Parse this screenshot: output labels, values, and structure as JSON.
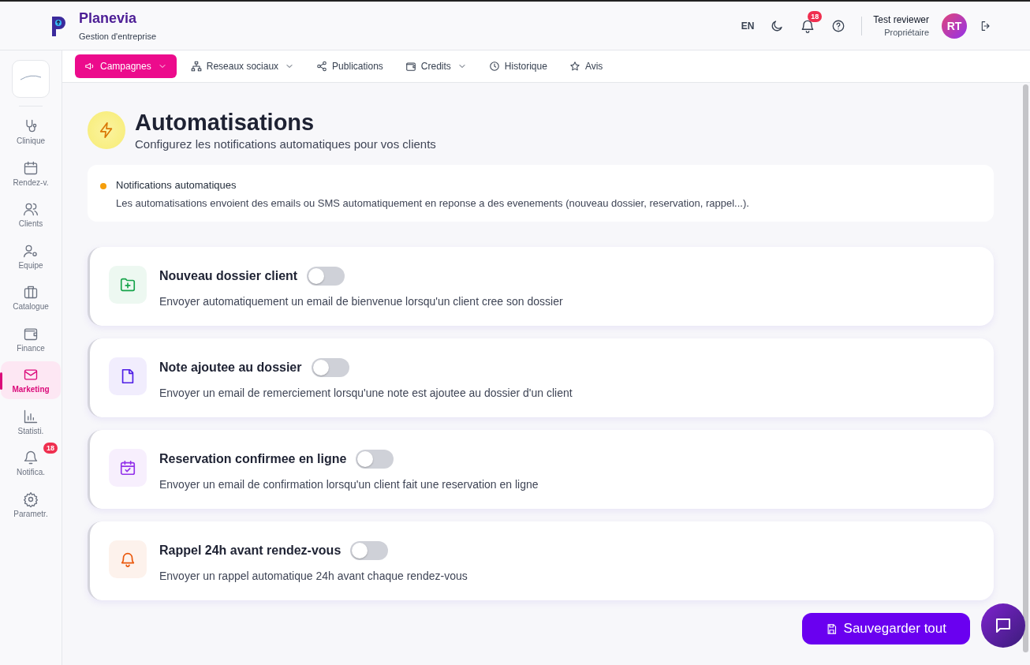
{
  "header": {
    "brand": "Planevia",
    "subtitle": "Gestion d'entreprise",
    "language": "EN",
    "notification_count": "18",
    "user_name": "Test reviewer",
    "user_role": "Propriétaire",
    "avatar_initials": "RT"
  },
  "sidebar": {
    "items": [
      {
        "label": "Clinique",
        "selected": false
      },
      {
        "label": "Rendez-v.",
        "selected": false
      },
      {
        "label": "Clients",
        "selected": false
      },
      {
        "label": "Equipe",
        "selected": false
      },
      {
        "label": "Catalogue",
        "selected": false
      },
      {
        "label": "Finance",
        "selected": false
      },
      {
        "label": "Marketing",
        "selected": true
      },
      {
        "label": "Statisti.",
        "selected": false
      },
      {
        "label": "Notifica.",
        "selected": false,
        "badge": "18"
      },
      {
        "label": "Parametr.",
        "selected": false
      }
    ]
  },
  "tabs": [
    {
      "label": "Campagnes",
      "selected": true,
      "dropdown": true
    },
    {
      "label": "Reseaux sociaux",
      "selected": false,
      "dropdown": true
    },
    {
      "label": "Publications",
      "selected": false,
      "dropdown": false
    },
    {
      "label": "Credits",
      "selected": false,
      "dropdown": true
    },
    {
      "label": "Historique",
      "selected": false,
      "dropdown": false
    },
    {
      "label": "Avis",
      "selected": false,
      "dropdown": false
    }
  ],
  "page": {
    "title": "Automatisations",
    "subtitle": "Configurez les notifications automatiques pour vos clients"
  },
  "info": {
    "title": "Notifications automatiques",
    "text": "Les automatisations envoient des emails ou SMS automatiquement en reponse a des evenements (nouveau dossier, reservation, rappel...).",
    "color": "#f59e0b"
  },
  "automations": [
    {
      "title": "Nouveau dossier client",
      "description": "Envoyer automatiquement un email de bienvenue lorsqu'un client cree son dossier",
      "on": false,
      "color": "#16a34a"
    },
    {
      "title": "Note ajoutee au dossier",
      "description": "Envoyer un email de remerciement lorsqu'une note est ajoutee au dossier d'un client",
      "on": false,
      "color": "#4f1ee6"
    },
    {
      "title": "Reservation confirmee en ligne",
      "description": "Envoyer un email de confirmation lorsqu'un client fait une reservation en ligne",
      "on": false,
      "color": "#9333ea"
    },
    {
      "title": "Rappel 24h avant rendez-vous",
      "description": "Envoyer un rappel automatique 24h avant chaque rendez-vous",
      "on": false,
      "color": "#ea580c"
    }
  ],
  "save_button": "Sauvegarder tout"
}
